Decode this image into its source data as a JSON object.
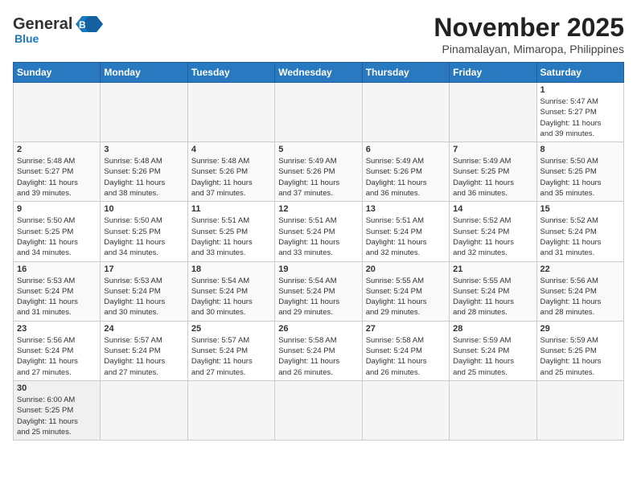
{
  "header": {
    "logo_general": "General",
    "logo_blue": "Blue",
    "month_title": "November 2025",
    "subtitle": "Pinamalayan, Mimaropa, Philippines"
  },
  "weekdays": [
    "Sunday",
    "Monday",
    "Tuesday",
    "Wednesday",
    "Thursday",
    "Friday",
    "Saturday"
  ],
  "weeks": [
    [
      {
        "day": "",
        "info": ""
      },
      {
        "day": "",
        "info": ""
      },
      {
        "day": "",
        "info": ""
      },
      {
        "day": "",
        "info": ""
      },
      {
        "day": "",
        "info": ""
      },
      {
        "day": "",
        "info": ""
      },
      {
        "day": "1",
        "info": "Sunrise: 5:47 AM\nSunset: 5:27 PM\nDaylight: 11 hours\nand 39 minutes."
      }
    ],
    [
      {
        "day": "2",
        "info": "Sunrise: 5:48 AM\nSunset: 5:27 PM\nDaylight: 11 hours\nand 39 minutes."
      },
      {
        "day": "3",
        "info": "Sunrise: 5:48 AM\nSunset: 5:26 PM\nDaylight: 11 hours\nand 38 minutes."
      },
      {
        "day": "4",
        "info": "Sunrise: 5:48 AM\nSunset: 5:26 PM\nDaylight: 11 hours\nand 37 minutes."
      },
      {
        "day": "5",
        "info": "Sunrise: 5:49 AM\nSunset: 5:26 PM\nDaylight: 11 hours\nand 37 minutes."
      },
      {
        "day": "6",
        "info": "Sunrise: 5:49 AM\nSunset: 5:26 PM\nDaylight: 11 hours\nand 36 minutes."
      },
      {
        "day": "7",
        "info": "Sunrise: 5:49 AM\nSunset: 5:25 PM\nDaylight: 11 hours\nand 36 minutes."
      },
      {
        "day": "8",
        "info": "Sunrise: 5:50 AM\nSunset: 5:25 PM\nDaylight: 11 hours\nand 35 minutes."
      }
    ],
    [
      {
        "day": "9",
        "info": "Sunrise: 5:50 AM\nSunset: 5:25 PM\nDaylight: 11 hours\nand 34 minutes."
      },
      {
        "day": "10",
        "info": "Sunrise: 5:50 AM\nSunset: 5:25 PM\nDaylight: 11 hours\nand 34 minutes."
      },
      {
        "day": "11",
        "info": "Sunrise: 5:51 AM\nSunset: 5:25 PM\nDaylight: 11 hours\nand 33 minutes."
      },
      {
        "day": "12",
        "info": "Sunrise: 5:51 AM\nSunset: 5:24 PM\nDaylight: 11 hours\nand 33 minutes."
      },
      {
        "day": "13",
        "info": "Sunrise: 5:51 AM\nSunset: 5:24 PM\nDaylight: 11 hours\nand 32 minutes."
      },
      {
        "day": "14",
        "info": "Sunrise: 5:52 AM\nSunset: 5:24 PM\nDaylight: 11 hours\nand 32 minutes."
      },
      {
        "day": "15",
        "info": "Sunrise: 5:52 AM\nSunset: 5:24 PM\nDaylight: 11 hours\nand 31 minutes."
      }
    ],
    [
      {
        "day": "16",
        "info": "Sunrise: 5:53 AM\nSunset: 5:24 PM\nDaylight: 11 hours\nand 31 minutes."
      },
      {
        "day": "17",
        "info": "Sunrise: 5:53 AM\nSunset: 5:24 PM\nDaylight: 11 hours\nand 30 minutes."
      },
      {
        "day": "18",
        "info": "Sunrise: 5:54 AM\nSunset: 5:24 PM\nDaylight: 11 hours\nand 30 minutes."
      },
      {
        "day": "19",
        "info": "Sunrise: 5:54 AM\nSunset: 5:24 PM\nDaylight: 11 hours\nand 29 minutes."
      },
      {
        "day": "20",
        "info": "Sunrise: 5:55 AM\nSunset: 5:24 PM\nDaylight: 11 hours\nand 29 minutes."
      },
      {
        "day": "21",
        "info": "Sunrise: 5:55 AM\nSunset: 5:24 PM\nDaylight: 11 hours\nand 28 minutes."
      },
      {
        "day": "22",
        "info": "Sunrise: 5:56 AM\nSunset: 5:24 PM\nDaylight: 11 hours\nand 28 minutes."
      }
    ],
    [
      {
        "day": "23",
        "info": "Sunrise: 5:56 AM\nSunset: 5:24 PM\nDaylight: 11 hours\nand 27 minutes."
      },
      {
        "day": "24",
        "info": "Sunrise: 5:57 AM\nSunset: 5:24 PM\nDaylight: 11 hours\nand 27 minutes."
      },
      {
        "day": "25",
        "info": "Sunrise: 5:57 AM\nSunset: 5:24 PM\nDaylight: 11 hours\nand 27 minutes."
      },
      {
        "day": "26",
        "info": "Sunrise: 5:58 AM\nSunset: 5:24 PM\nDaylight: 11 hours\nand 26 minutes."
      },
      {
        "day": "27",
        "info": "Sunrise: 5:58 AM\nSunset: 5:24 PM\nDaylight: 11 hours\nand 26 minutes."
      },
      {
        "day": "28",
        "info": "Sunrise: 5:59 AM\nSunset: 5:24 PM\nDaylight: 11 hours\nand 25 minutes."
      },
      {
        "day": "29",
        "info": "Sunrise: 5:59 AM\nSunset: 5:25 PM\nDaylight: 11 hours\nand 25 minutes."
      }
    ],
    [
      {
        "day": "30",
        "info": "Sunrise: 6:00 AM\nSunset: 5:25 PM\nDaylight: 11 hours\nand 25 minutes."
      },
      {
        "day": "",
        "info": ""
      },
      {
        "day": "",
        "info": ""
      },
      {
        "day": "",
        "info": ""
      },
      {
        "day": "",
        "info": ""
      },
      {
        "day": "",
        "info": ""
      },
      {
        "day": "",
        "info": ""
      }
    ]
  ]
}
